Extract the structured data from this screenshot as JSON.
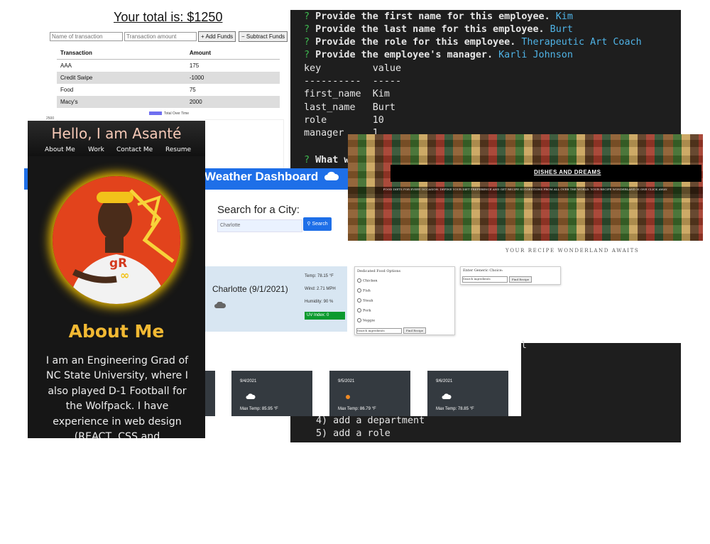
{
  "budget": {
    "total": "Your total is: $1250",
    "name_placeholder": "Name of transaction",
    "amount_placeholder": "Transaction amount",
    "add_label": "+ Add Funds",
    "subtract_label": "− Subtract Funds",
    "columns": [
      "Transaction",
      "Amount"
    ],
    "rows": [
      {
        "name": "AAA",
        "amount": "175"
      },
      {
        "name": "Credit Swipe",
        "amount": "-1000"
      },
      {
        "name": "Food",
        "amount": "75"
      },
      {
        "name": "Macy's",
        "amount": "2000"
      }
    ],
    "chart_y_tick": "2500",
    "legend": "Total Over Time",
    "legend_color": "#6f6ff0"
  },
  "terminal": {
    "prompts": [
      {
        "q": "?",
        "text": "Provide the first name for this employee.",
        "answer": "Kim"
      },
      {
        "q": "?",
        "text": "Provide the last name for this employee.",
        "answer": "Burt"
      },
      {
        "q": "?",
        "text": "Provide the role for this employee.",
        "answer": "Therapeutic Art Coach"
      },
      {
        "q": "?",
        "text": "Provide the employee's manager.",
        "answer": "Karli Johnson"
      }
    ],
    "table_header": "key         value",
    "table_divider": "----------  -----",
    "table_rows": [
      "first_name  Kim",
      "last_name   Burt",
      "role        10",
      "manager     1"
    ],
    "next_prompt_q": "?",
    "next_prompt": "What w",
    "menu": [
      "4) add a department",
      "5) add a role"
    ],
    "cursor": "l"
  },
  "weather": {
    "title": "Weather Dashboard",
    "search_label": "Search for a City:",
    "search_value": "Charlotte",
    "search_button": "Search",
    "current": {
      "city": "Charlotte (9/1/2021)",
      "temp": "Temp: 78.15 °F",
      "wind": "Wind: 2.71 MPH",
      "humidity": "Humidity: 90 %",
      "uv": "UV Index: 0"
    },
    "forecast": [
      {
        "date": "9/4/2021",
        "temp": "Max Temp: 85.95 °F"
      },
      {
        "date": "9/5/2021",
        "temp": "Max Temp: 86.79 °F"
      },
      {
        "date": "9/6/2021",
        "temp": "Max Temp: 78.85 °F"
      }
    ]
  },
  "recipe": {
    "banner_title": "DISHES AND DREAMS",
    "banner_text": "FOOD DIETS FOR EVERY OCCASION. DEFINE YOUR DIET PREFERENCE AND GET RECIPE SUGGESTIONS FROM ALL OVER THE WORLD. YOUR RECIPE WONDERLAND IS ONE CLICK AWAY.",
    "tagline": "YOUR RECIPE WONDERLAND AWAITS",
    "diet_heading": "Dedicated Food Options",
    "diet_options": [
      "Chicken",
      "Fish",
      "Steak",
      "Pork",
      "Veggie"
    ],
    "diet_input": "Search ingredients",
    "diet_button": "Find Recipe",
    "generic_heading": "Enter Generic Choice:",
    "generic_input": "Search ingredients",
    "generic_button": "Find Recipe"
  },
  "portfolio": {
    "title": "Hello, I am Asanté",
    "nav": [
      "About Me",
      "Work",
      "Contact Me",
      "Resume"
    ],
    "about_heading": "About Me",
    "bio": "I am an Engineering Grad of NC State University, where I also played D-1 Football for the Wolfpack. I have experience in web design (REACT, CSS and",
    "shirt_text": "gR",
    "accent_color": "#f2b933"
  }
}
